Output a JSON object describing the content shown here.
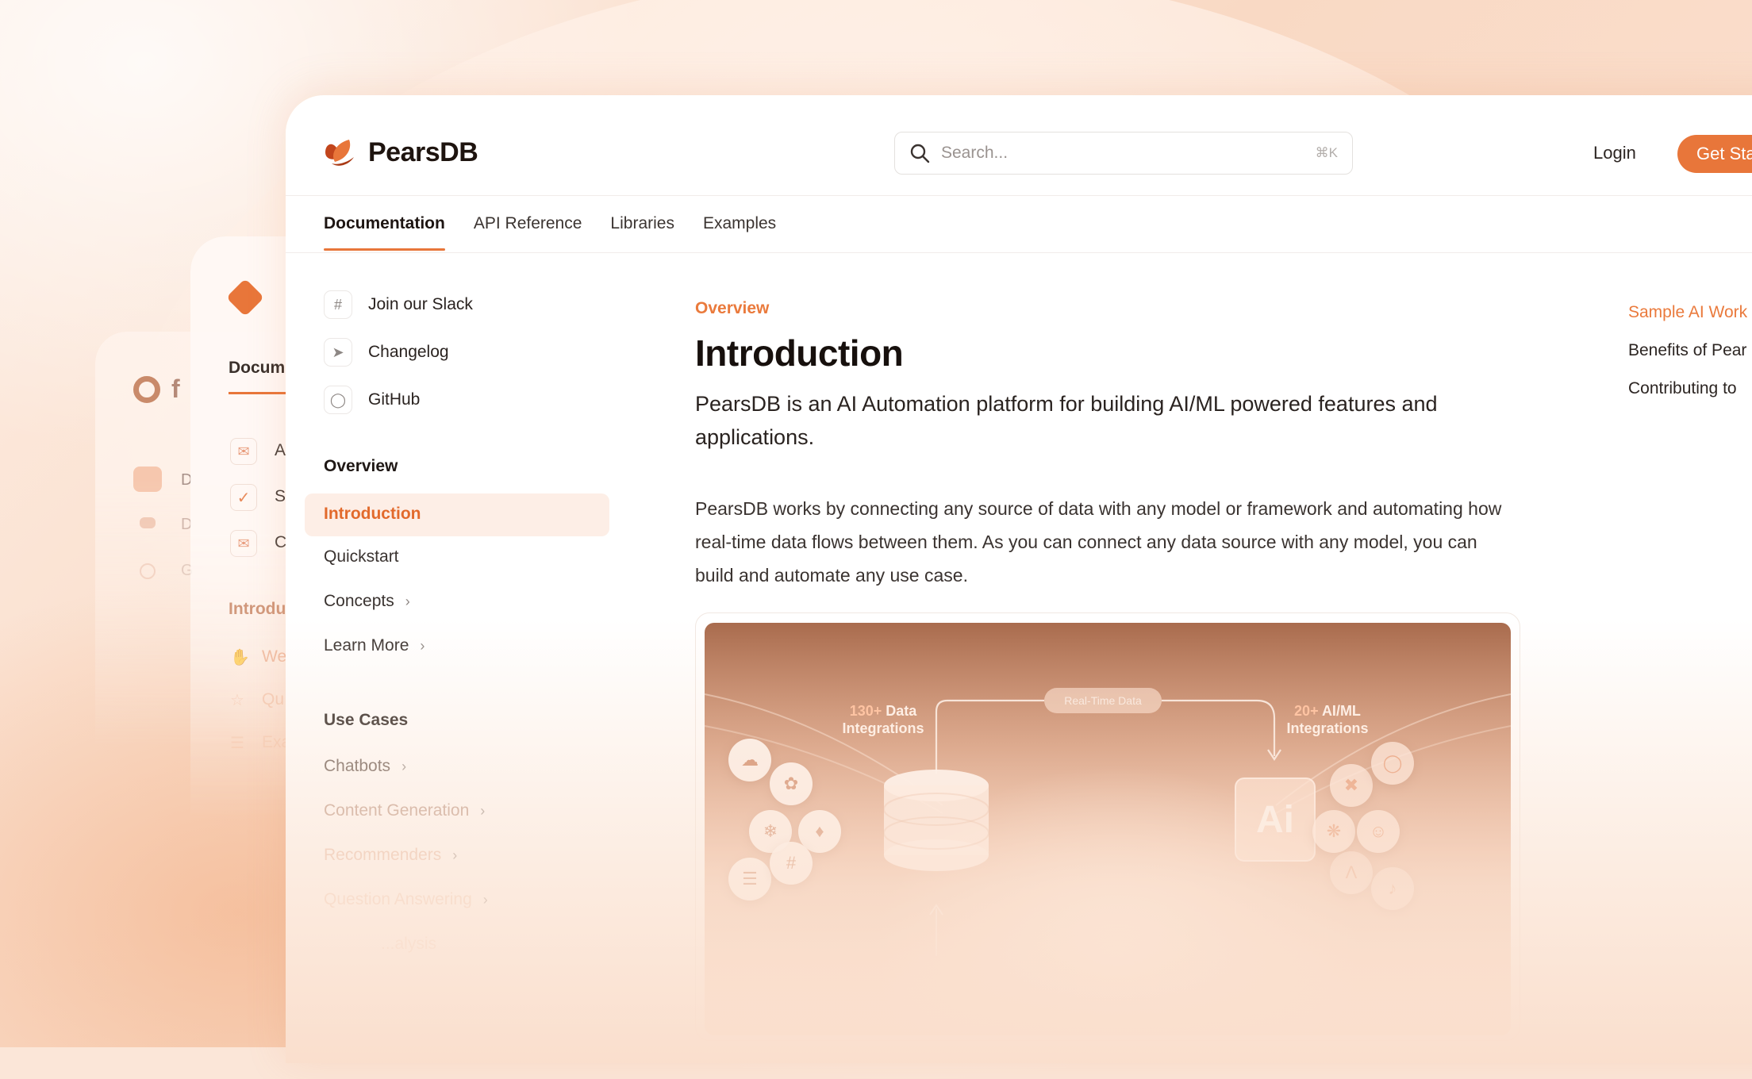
{
  "brand": {
    "name": "PearsDB",
    "accent": "#e8763a"
  },
  "header": {
    "search_placeholder": "Search...",
    "search_shortcut": "⌘K",
    "login": "Login",
    "cta": "Get Sta"
  },
  "tabs": [
    {
      "label": "Documentation",
      "active": true
    },
    {
      "label": "API Reference"
    },
    {
      "label": "Libraries"
    },
    {
      "label": "Examples"
    }
  ],
  "sidebar": {
    "links": [
      {
        "label": "Join our Slack",
        "icon": "slack-icon"
      },
      {
        "label": "Changelog",
        "icon": "rocket-icon"
      },
      {
        "label": "GitHub",
        "icon": "github-icon"
      }
    ],
    "overview_heading": "Overview",
    "overview_items": [
      {
        "label": "Introduction",
        "active": true
      },
      {
        "label": "Quickstart"
      },
      {
        "label": "Concepts"
      },
      {
        "label": "Learn More"
      }
    ],
    "usecases_heading": "Use Cases",
    "usecases_items": [
      {
        "label": "Chatbots"
      },
      {
        "label": "Content Generation"
      },
      {
        "label": "Recommenders"
      },
      {
        "label": "Question Answering"
      },
      {
        "label": "...alysis"
      }
    ]
  },
  "content": {
    "breadcrumb": "Overview",
    "title": "Introduction",
    "lead": "PearsDB is an AI Automation platform for building AI/ML powered features and applications.",
    "body": "PearsDB works by connecting any source of data with any model or framework and automating how real-time data flows between them. As you can connect any data source with any model, you can build and automate any use case."
  },
  "illustration": {
    "left_count": "130+",
    "left_label_1": "Data",
    "left_label_2": "Integrations",
    "pill": "Real-Time Data",
    "right_count": "20+",
    "right_label_1": "AI/ML",
    "right_label_2": "Integrations",
    "chip": "Ai"
  },
  "toc": [
    {
      "label": "Sample AI Work",
      "active": true
    },
    {
      "label": "Benefits of Pear"
    },
    {
      "label": "Contributing to"
    }
  ],
  "back_cards": {
    "card1_tab": "Docum",
    "card1_items": [
      "A",
      "S",
      "C"
    ],
    "card1_heading": "Introdu",
    "card1_sub": [
      "We",
      "Qu",
      "Exa"
    ],
    "card2_title": "f",
    "card2_items": [
      "D",
      "D",
      "G"
    ]
  }
}
